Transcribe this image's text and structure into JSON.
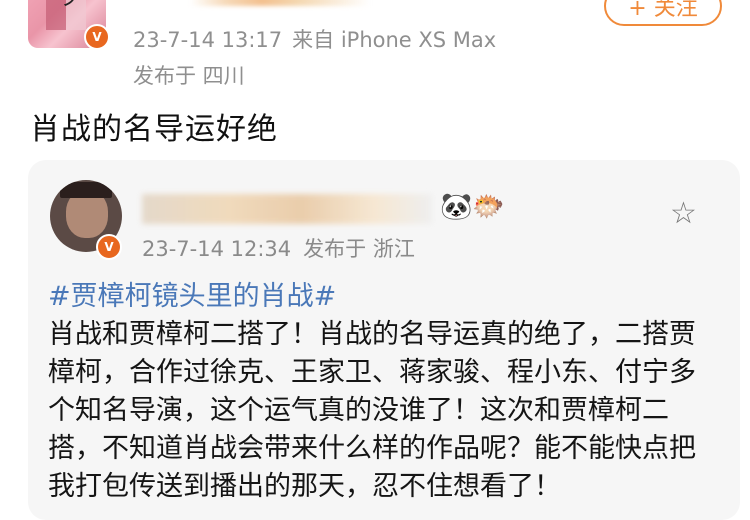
{
  "top_post": {
    "avatar_mark": "ヲ",
    "vbadge": "V",
    "follow_label": "+ 关注",
    "date": "23-7-14 13:17",
    "device": "来自 iPhone XS Max",
    "location": "发布于 四川",
    "text": "肖战的名导运好绝"
  },
  "repost": {
    "vbadge": "V",
    "emoji_1": "🐼",
    "emoji_2": "🐡",
    "star_icon": "☆",
    "date": "23-7-14 12:34",
    "location": "发布于 浙江",
    "hashtag": "#贾樟柯镜头里的肖战#",
    "body": "肖战和贾樟柯二搭了！肖战的名导运真的绝了，二搭贾樟柯，合作过徐克、王家卫、蒋家骏、程小东、付宁多个知名导演，这个运气真的没谁了！这次和贾樟柯二搭，不知道肖战会带来什么样的作品呢？能不能快点把我打包传送到播出的那天，忍不住想看了！"
  },
  "colors": {
    "accent_orange": "#f08a3a",
    "meta_grey": "#8f8f8f",
    "hashtag_blue": "#4a78b8",
    "card_bg": "#f6f6f6"
  }
}
